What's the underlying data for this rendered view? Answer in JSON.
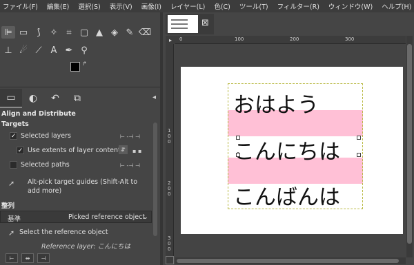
{
  "menubar": {
    "items": [
      "ファイル(F)",
      "編集(E)",
      "選択(S)",
      "表示(V)",
      "画像(I)",
      "レイヤー(L)",
      "色(C)",
      "ツール(T)",
      "フィルター(R)",
      "ウィンドウ(W)",
      "ヘルプ(H)"
    ]
  },
  "toolbox": {
    "row1": [
      "align-tool-icon",
      "rect-select-icon",
      "free-select-icon",
      "fuzzy-select-icon",
      "crop-icon",
      "unified-transform-icon",
      "warp-transform-icon",
      "bucket-fill-icon",
      "paintbrush-icon",
      "eraser-icon"
    ],
    "row2": [
      "clone-icon",
      "smudge-icon",
      "paths-icon",
      "text-icon",
      "color-picker-icon",
      "zoom-icon"
    ]
  },
  "options": {
    "panel_title": "Align and Distribute",
    "targets_heading": "Targets",
    "selected_layers": "Selected layers",
    "use_extents": "Use extents of layer contents",
    "selected_paths": "Selected paths",
    "alt_pick": "Alt-pick target guides (Shift-Alt to add more)",
    "align_heading": "整列",
    "reference_label": "基準",
    "reference_value": "Picked reference object",
    "select_reference": "Select the reference object",
    "reference_layer": "Reference layer: こんにちは"
  },
  "canvas": {
    "image_tab_thumb_lines": [
      "おはよう",
      "こんにちは",
      "こんばんは"
    ],
    "lines": [
      "おはよう",
      "こんにちは",
      "こんばんは"
    ],
    "ruler_top": [
      "0",
      "100",
      "200",
      "300"
    ],
    "ruler_left": [
      "1",
      "0",
      "0",
      "2",
      "0",
      "0",
      "3",
      "0",
      "0"
    ],
    "highlight_color": "#ffc0d6",
    "selection_border_color": "#b9b943"
  }
}
